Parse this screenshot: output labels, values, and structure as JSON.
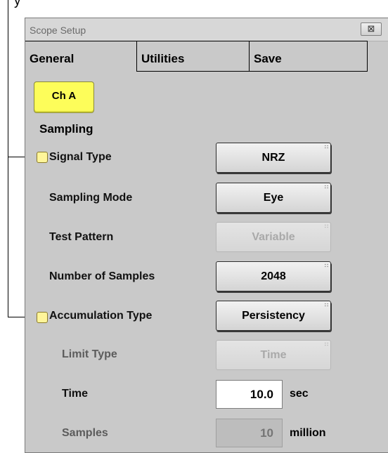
{
  "callout_text": "y",
  "window": {
    "title": "Scope Setup",
    "close_glyph": "⊠"
  },
  "tabs": [
    "General",
    "Utilities",
    "Save"
  ],
  "channel_button": "Ch A",
  "section_heading": "Sampling",
  "rows": {
    "signal_type": {
      "label": "Signal Type",
      "value": "NRZ"
    },
    "sampling_mode": {
      "label": "Sampling Mode",
      "value": "Eye"
    },
    "test_pattern": {
      "label": "Test Pattern",
      "value": "Variable"
    },
    "number_of_samples": {
      "label": "Number of Samples",
      "value": "2048"
    },
    "accumulation_type": {
      "label": "Accumulation Type",
      "value": "Persistency"
    },
    "limit_type": {
      "label": "Limit Type",
      "value": "Time"
    },
    "time": {
      "label": "Time",
      "value": "10.0",
      "unit": "sec"
    },
    "samples": {
      "label": "Samples",
      "value": "10",
      "unit": "million"
    }
  },
  "colors": {
    "panel_bg": "#c9c9c9",
    "channel_button": "#fdfd5a",
    "checkbox": "#fff59a"
  },
  "icons": {
    "close": "close-icon",
    "menu_indicator": "dropdown-indicator-icon"
  }
}
